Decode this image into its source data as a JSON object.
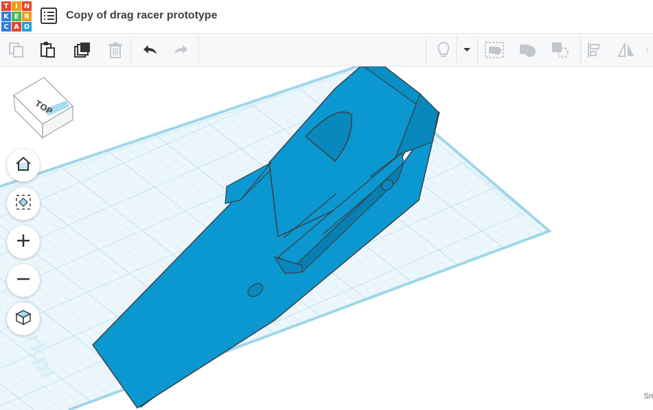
{
  "app": {
    "logo_letters": [
      "T",
      "I",
      "N",
      "K",
      "E",
      "R",
      "C",
      "A",
      "D"
    ],
    "logo_colors": [
      "#e6442b",
      "#f29a1d",
      "#f2c81d",
      "#2a7de1",
      "#1aa3d9",
      "#49b85c",
      "#2a7de1",
      "#1aa3d9",
      "#e6442b"
    ]
  },
  "design": {
    "title": "Copy of drag racer prototype"
  },
  "toolbar": {
    "items": [
      {
        "name": "copy-icon",
        "enabled": false
      },
      {
        "name": "paste-icon",
        "enabled": true
      },
      {
        "name": "duplicate-icon",
        "enabled": true
      },
      {
        "name": "delete-icon",
        "enabled": false
      },
      {
        "name": "undo-icon",
        "enabled": true
      },
      {
        "name": "redo-icon",
        "enabled": false
      },
      {
        "name": "lightbulb-icon",
        "enabled": false
      },
      {
        "name": "chevron-down-icon",
        "enabled": true
      },
      {
        "name": "group-icon",
        "enabled": false
      },
      {
        "name": "ungroup-icon",
        "enabled": false
      },
      {
        "name": "hole-icon",
        "enabled": false
      },
      {
        "name": "align-icon",
        "enabled": false
      },
      {
        "name": "mirror-icon",
        "enabled": false
      }
    ]
  },
  "viewcube": {
    "face_label": "TOP"
  },
  "nav_buttons": [
    "home-view-icon",
    "fit-all-icon",
    "zoom-in-icon",
    "zoom-out-icon",
    "perspective-icon"
  ],
  "workplane": {
    "label": "Workpl",
    "corner_text": "Sn"
  },
  "colors": {
    "shape": "#0b98d1",
    "shape_dark": "#076f9c",
    "grid": "#bfe4f0",
    "plane": "#e9f5fa"
  }
}
